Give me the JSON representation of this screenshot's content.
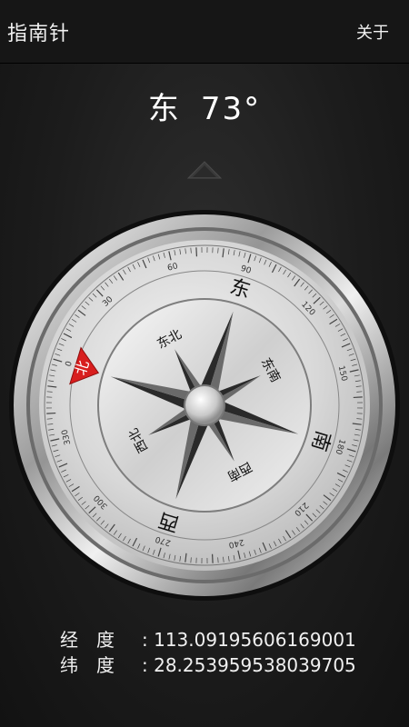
{
  "app": {
    "title": "指南针",
    "about_label": "关于"
  },
  "heading": {
    "direction": "东",
    "degrees": "73°",
    "value_deg": 73
  },
  "compass": {
    "cardinals": {
      "north": "北",
      "east": "东",
      "south": "南",
      "west": "西"
    },
    "intercardinals": {
      "ne": "东北",
      "se": "东南",
      "sw": "西南",
      "nw": "西北"
    },
    "dial_numbers": [
      "0",
      "30",
      "60",
      "90",
      "120",
      "150",
      "180",
      "210",
      "240",
      "270",
      "300",
      "330"
    ],
    "north_marker_color": "#d81e1e"
  },
  "coords": {
    "longitude_label": "经　度",
    "longitude_value": ": 113.09195606169001",
    "latitude_label": "纬　度",
    "latitude_value": ": 28.253959538039705"
  }
}
